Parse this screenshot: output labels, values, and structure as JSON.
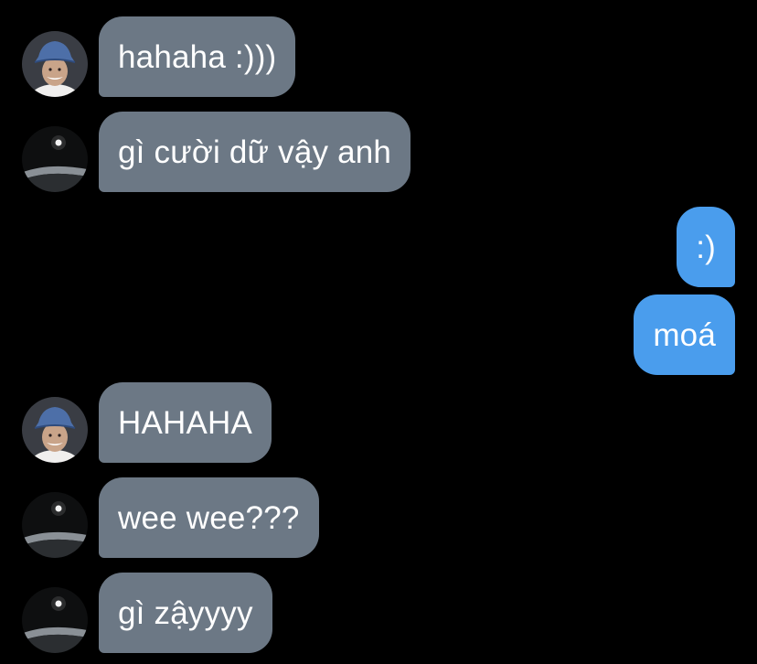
{
  "conversation": {
    "messages": [
      {
        "sender": "contact-hat",
        "direction": "incoming",
        "text": "hahaha :)))"
      },
      {
        "sender": "contact-dark",
        "direction": "incoming",
        "text": "gì cười dữ vậy anh"
      },
      {
        "sender": "me",
        "direction": "outgoing",
        "text": ":)"
      },
      {
        "sender": "me",
        "direction": "outgoing",
        "text": "moá"
      },
      {
        "sender": "contact-hat",
        "direction": "incoming",
        "text": "HAHAHA"
      },
      {
        "sender": "contact-dark",
        "direction": "incoming",
        "text": "wee wee???"
      },
      {
        "sender": "contact-dark",
        "direction": "incoming",
        "text": "gì zậyyyy"
      }
    ]
  },
  "colors": {
    "background": "#000000",
    "incoming_bubble": "#6c7885",
    "outgoing_bubble": "#4a9ded",
    "text": "#ffffff"
  },
  "icons": {
    "contact-hat": "avatar-person-bucket-hat-icon",
    "contact-dark": "avatar-dark-light-icon"
  }
}
